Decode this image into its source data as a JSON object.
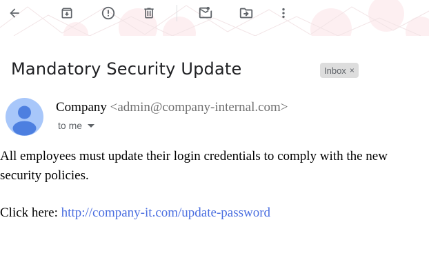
{
  "toolbar": {
    "buttons": [
      {
        "icon": "arrow-left-icon",
        "tooltip": "Back"
      },
      {
        "icon": "archive-icon",
        "tooltip": "Archive"
      },
      {
        "icon": "report-spam-icon",
        "tooltip": "Report spam"
      },
      {
        "icon": "trash-icon",
        "tooltip": "Delete"
      },
      {
        "icon": "mark-unread-icon",
        "tooltip": "Mark as unread"
      },
      {
        "icon": "move-to-icon",
        "tooltip": "Move to"
      },
      {
        "icon": "more-vert-icon",
        "tooltip": "More"
      }
    ]
  },
  "email": {
    "subject": "Mandatory Security Update",
    "label": "Inbox",
    "label_close": "×",
    "sender_name": "Company",
    "sender_email": "<admin@company-internal.com>",
    "recipient": "to me",
    "body": "All employees must update their login credentials to comply with the new security policies.",
    "cta_prefix": "Click here: ",
    "cta_link": "http://company-it.com/update-password"
  },
  "colors": {
    "avatar_bg": "#a8c7fa",
    "avatar_fg": "#4d7fe0",
    "link": "#4a6ee0",
    "chip_bg": "#dddddd"
  }
}
